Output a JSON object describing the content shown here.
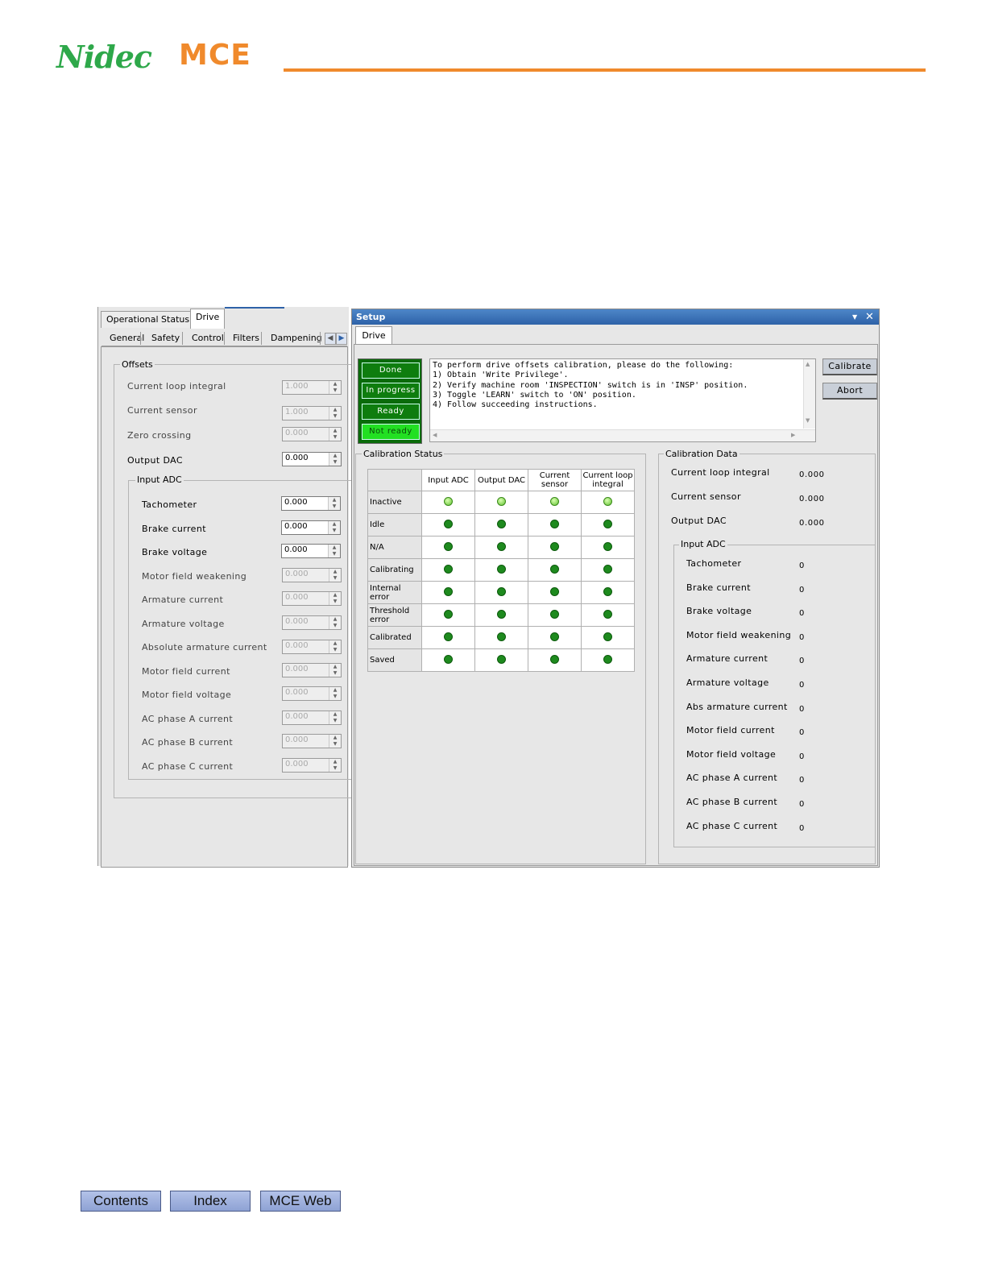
{
  "header": {
    "logo_nidec": "Nidec",
    "logo_mce": "MCE",
    "brand_green": "#2ea84a",
    "brand_orange": "#f08a2c"
  },
  "left_panel": {
    "tabs": [
      "Operational Status",
      "Drive"
    ],
    "active_tab": "Drive",
    "subtabs": [
      "General",
      "Safety",
      "Control",
      "Filters",
      "Dampening"
    ],
    "offsets_title": "Offsets",
    "fields": [
      {
        "label": "Current loop integral",
        "value": "1.000"
      },
      {
        "label": "Current sensor",
        "value": "1.000"
      },
      {
        "label": "Zero crossing",
        "value": "0.000"
      },
      {
        "label": "Output DAC",
        "value": "0.000"
      }
    ],
    "input_adc_title": "Input ADC",
    "adc_fields": [
      {
        "label": "Tachometer",
        "value": "0.000"
      },
      {
        "label": "Brake current",
        "value": "0.000"
      },
      {
        "label": "Brake voltage",
        "value": "0.000"
      },
      {
        "label": "Motor field weakening",
        "value": "0.000"
      },
      {
        "label": "Armature current",
        "value": "0.000"
      },
      {
        "label": "Armature voltage",
        "value": "0.000"
      },
      {
        "label": "Absolute armature current",
        "value": "0.000"
      },
      {
        "label": "Motor field current",
        "value": "0.000"
      },
      {
        "label": "Motor field voltage",
        "value": "0.000"
      },
      {
        "label": "AC phase A current",
        "value": "0.000"
      },
      {
        "label": "AC phase B current",
        "value": "0.000"
      },
      {
        "label": "AC phase C current",
        "value": "0.000"
      }
    ]
  },
  "setup": {
    "title": "Setup",
    "tab": "Drive",
    "status_buttons": [
      "Done",
      "In progress",
      "Ready",
      "Not ready"
    ],
    "instructions": [
      "To perform drive offsets calibration, please do the following:",
      "1) Obtain 'Write Privilege'.",
      "2) Verify machine room 'INSPECTION' switch is in 'INSP' position.",
      "3) Toggle 'LEARN' switch to 'ON' position.",
      "4) Follow succeeding instructions."
    ],
    "calibrate_label": "Calibrate",
    "abort_label": "Abort",
    "calibration_status": {
      "title": "Calibration Status",
      "columns": [
        [
          "Input ADC",
          ""
        ],
        [
          "Output DAC",
          ""
        ],
        [
          "Current",
          "sensor"
        ],
        [
          "Current loop",
          "integral"
        ]
      ],
      "rows": [
        [
          "Inactive",
          ""
        ],
        [
          "Idle",
          ""
        ],
        [
          "N/A",
          ""
        ],
        [
          "Calibrating",
          ""
        ],
        [
          "Internal",
          "error"
        ],
        [
          "Threshold",
          "error"
        ],
        [
          "Calibrated",
          ""
        ],
        [
          "Saved",
          ""
        ]
      ],
      "lit_row": "Inactive"
    },
    "calibration_data": {
      "title": "Calibration Data",
      "items": [
        {
          "label": "Current loop integral",
          "value": "0.000"
        },
        {
          "label": "Current sensor",
          "value": "0.000"
        },
        {
          "label": "Output DAC",
          "value": "0.000"
        }
      ],
      "input_adc_title": "Input ADC",
      "adc_items": [
        {
          "label": "Tachometer",
          "value": "0"
        },
        {
          "label": "Brake current",
          "value": "0"
        },
        {
          "label": "Brake voltage",
          "value": "0"
        },
        {
          "label": "Motor field weakening",
          "value": "0"
        },
        {
          "label": "Armature current",
          "value": "0"
        },
        {
          "label": "Armature voltage",
          "value": "0"
        },
        {
          "label": "Abs armature current",
          "value": "0"
        },
        {
          "label": "Motor field current",
          "value": "0"
        },
        {
          "label": "Motor field voltage",
          "value": "0"
        },
        {
          "label": "AC phase A current",
          "value": "0"
        },
        {
          "label": "AC phase B current",
          "value": "0"
        },
        {
          "label": "AC phase C current",
          "value": "0"
        }
      ]
    }
  },
  "footer": {
    "buttons": [
      "Contents",
      "Index",
      "MCE Web"
    ]
  }
}
